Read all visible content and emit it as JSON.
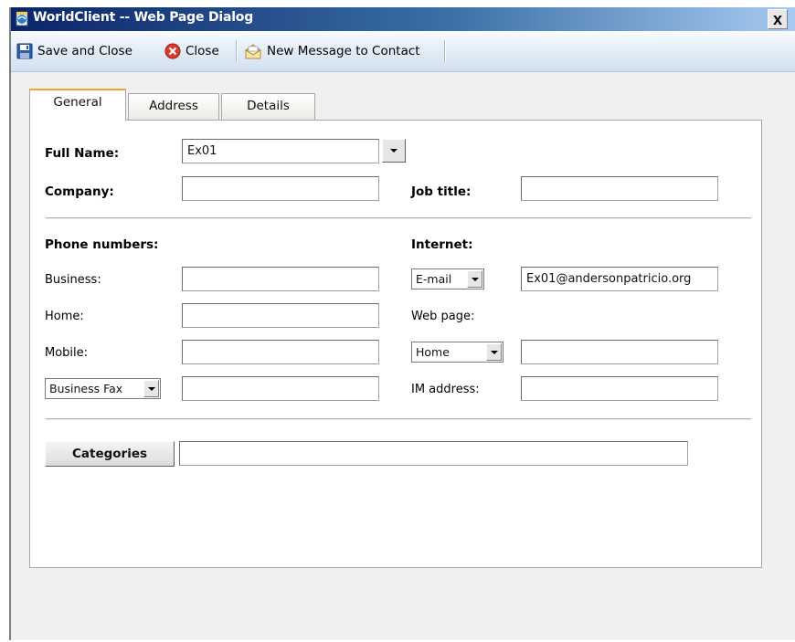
{
  "window": {
    "title": "WorldClient -- Web Page Dialog",
    "close_symbol": "x"
  },
  "toolbar": {
    "save_close_label": "Save and Close",
    "close_label": "Close",
    "new_message_label": "New Message to Contact"
  },
  "tabs": [
    {
      "label": "General",
      "active": true
    },
    {
      "label": "Address",
      "active": false
    },
    {
      "label": "Details",
      "active": false
    }
  ],
  "general": {
    "full_name_label": "Full Name:",
    "full_name_value": "Ex01",
    "company_label": "Company:",
    "company_value": "",
    "job_title_label": "Job title:",
    "job_title_value": "",
    "phone_header": "Phone numbers:",
    "business_label": "Business:",
    "business_value": "",
    "home_label": "Home:",
    "home_value": "",
    "mobile_label": "Mobile:",
    "mobile_value": "",
    "fax_type_selected": "Business Fax",
    "fax_value": "",
    "internet_header": "Internet:",
    "email_type_selected": "E-mail",
    "email_value": "Ex01@andersonpatricio.org",
    "web_page_label": "Web page:",
    "web_type_selected": "Home",
    "web_value": "",
    "im_label": "IM address:",
    "im_value": "",
    "categories_label": "Categories",
    "categories_value": ""
  },
  "icons": {
    "window": "ie-page-icon",
    "save": "floppy-disk-icon",
    "close": "red-x-circle-icon",
    "new_message": "envelope-icon"
  },
  "colors": {
    "titlebar_start": "#0a246a",
    "titlebar_end": "#a6caf0",
    "active_tab_accent": "#f0a030",
    "toolbar_bg": "#e2ecf7"
  }
}
